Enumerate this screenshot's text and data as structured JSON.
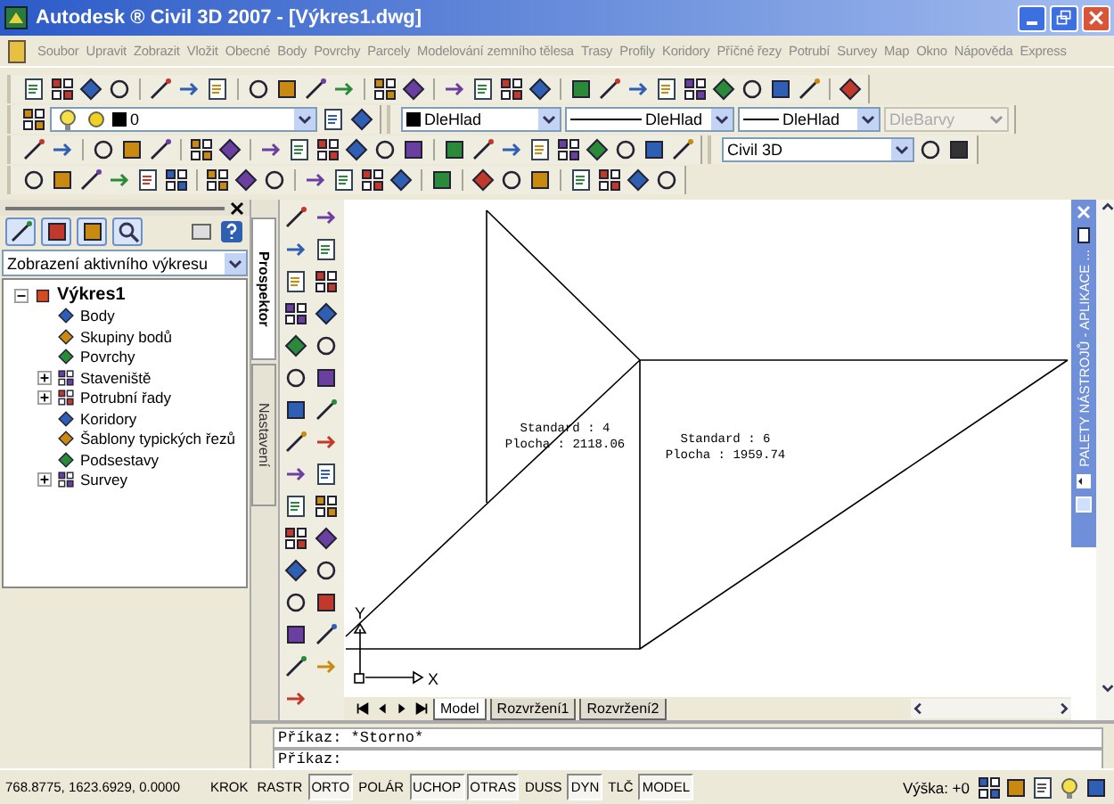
{
  "window": {
    "title": "Autodesk ® Civil 3D 2007 - [Výkres1.dwg]"
  },
  "menu": [
    "Soubor",
    "Upravit",
    "Zobrazit",
    "Vložit",
    "Obecné",
    "Body",
    "Povrchy",
    "Parcely",
    "Modelování zemního tělesa",
    "Trasy",
    "Profily",
    "Koridory",
    "Příčné řezy",
    "Potrubí",
    "Survey",
    "Map",
    "Okno",
    "Nápověda",
    "Express"
  ],
  "toolbars": {
    "layer": {
      "value": "0"
    },
    "color": {
      "value": "DleHlad"
    },
    "linetype": {
      "value": "DleHlad"
    },
    "lineweight": {
      "value": "DleHlad"
    },
    "plot_style": {
      "value": "DleBarvy",
      "disabled": true
    },
    "workspace": {
      "value": "Civil 3D"
    }
  },
  "prospector": {
    "view_select": "Zobrazení aktivního výkresu",
    "tree": [
      {
        "label": "Výkres1",
        "kind": "folder",
        "expanded": true,
        "children": [
          {
            "label": "Body",
            "kind": "leaf"
          },
          {
            "label": "Skupiny bodů",
            "kind": "leaf"
          },
          {
            "label": "Povrchy",
            "kind": "leaf"
          },
          {
            "label": "Staveniště",
            "kind": "folder",
            "expanded": false
          },
          {
            "label": "Potrubní řady",
            "kind": "folder",
            "expanded": false
          },
          {
            "label": "Koridory",
            "kind": "leaf"
          },
          {
            "label": "Šablony typických řezů",
            "kind": "leaf"
          },
          {
            "label": "Podsestavy",
            "kind": "leaf"
          },
          {
            "label": "Survey",
            "kind": "folder",
            "expanded": false
          }
        ]
      }
    ]
  },
  "side_tabs": [
    {
      "label": "Prospektor",
      "selected": true
    },
    {
      "label": "Nastavení",
      "selected": false
    }
  ],
  "drawing": {
    "labels": [
      {
        "lines": [
          "Standard : 4",
          "Plocha : 2118.06"
        ]
      },
      {
        "lines": [
          "Standard : 6",
          "Plocha : 1959.74"
        ]
      }
    ],
    "ucs": {
      "x": "X",
      "y": "Y"
    }
  },
  "layout_tabs": [
    {
      "label": "Model",
      "selected": true
    },
    {
      "label": "Rozvržení1",
      "selected": false
    },
    {
      "label": "Rozvržení2",
      "selected": false
    }
  ],
  "palette": {
    "title": "PALETY NÁSTROJŮ - APLIKACE ..."
  },
  "command_lines": [
    "Příkaz: *Storno*",
    "Příkaz:"
  ],
  "status_bar": {
    "coordinates": "768.8775, 1623.6929, 0.0000",
    "toggles": [
      {
        "label": "KROK",
        "on": false
      },
      {
        "label": "RASTR",
        "on": false
      },
      {
        "label": "ORTO",
        "on": true
      },
      {
        "label": "POLÁR",
        "on": false
      },
      {
        "label": "UCHOP",
        "on": true
      },
      {
        "label": "OTRAS",
        "on": true
      },
      {
        "label": "DUSS",
        "on": false
      },
      {
        "label": "DYN",
        "on": true
      },
      {
        "label": "TLČ",
        "on": false
      },
      {
        "label": "MODEL",
        "on": true
      }
    ],
    "height_label": "Výška: +0"
  }
}
